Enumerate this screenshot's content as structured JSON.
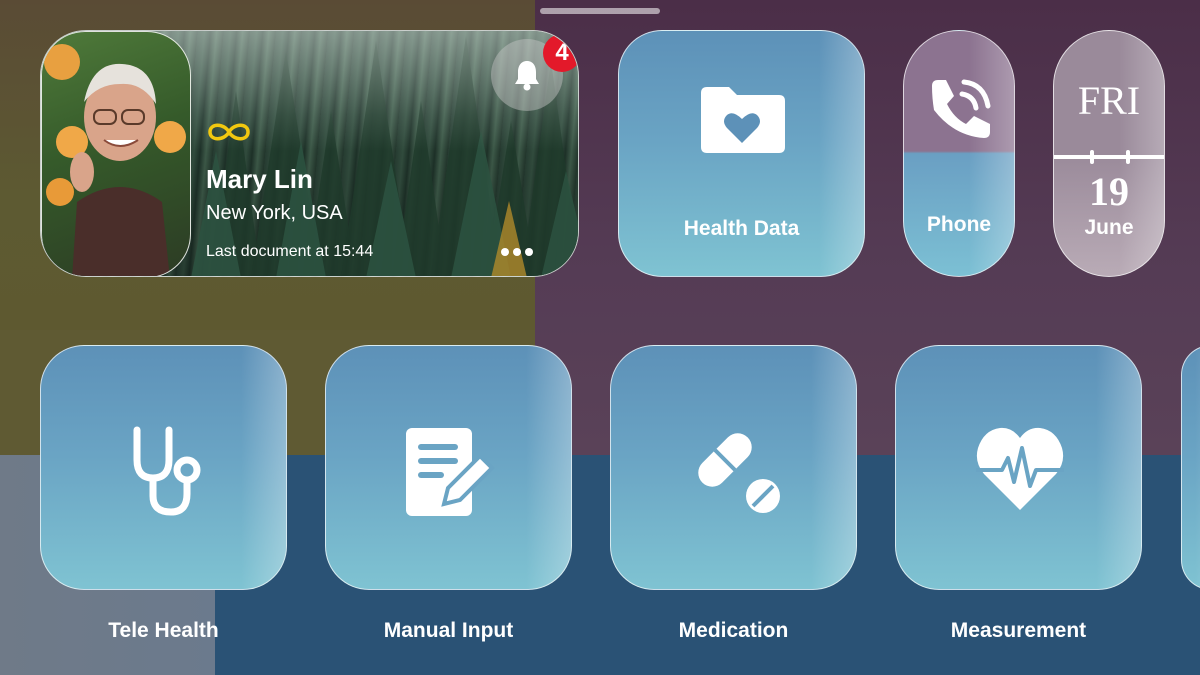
{
  "profile": {
    "name": "Mary Lin",
    "location": "New York, USA",
    "last_document": "Last document at 15:44",
    "notification_count": "4"
  },
  "top_tiles": {
    "health_data": "Health Data",
    "phone": "Phone",
    "calendar": {
      "day": "FRI",
      "date": "19",
      "month": "June"
    }
  },
  "apps": [
    {
      "label": "Tele Health",
      "icon": "stethoscope-icon"
    },
    {
      "label": "Manual Input",
      "icon": "document-edit-icon"
    },
    {
      "label": "Medication",
      "icon": "pills-icon"
    },
    {
      "label": "Measurement",
      "icon": "heart-pulse-icon"
    }
  ],
  "colors": {
    "badge": "#e3192a",
    "brand_accent": "#f2c80f",
    "tile_blue": "#6aa4c4"
  }
}
